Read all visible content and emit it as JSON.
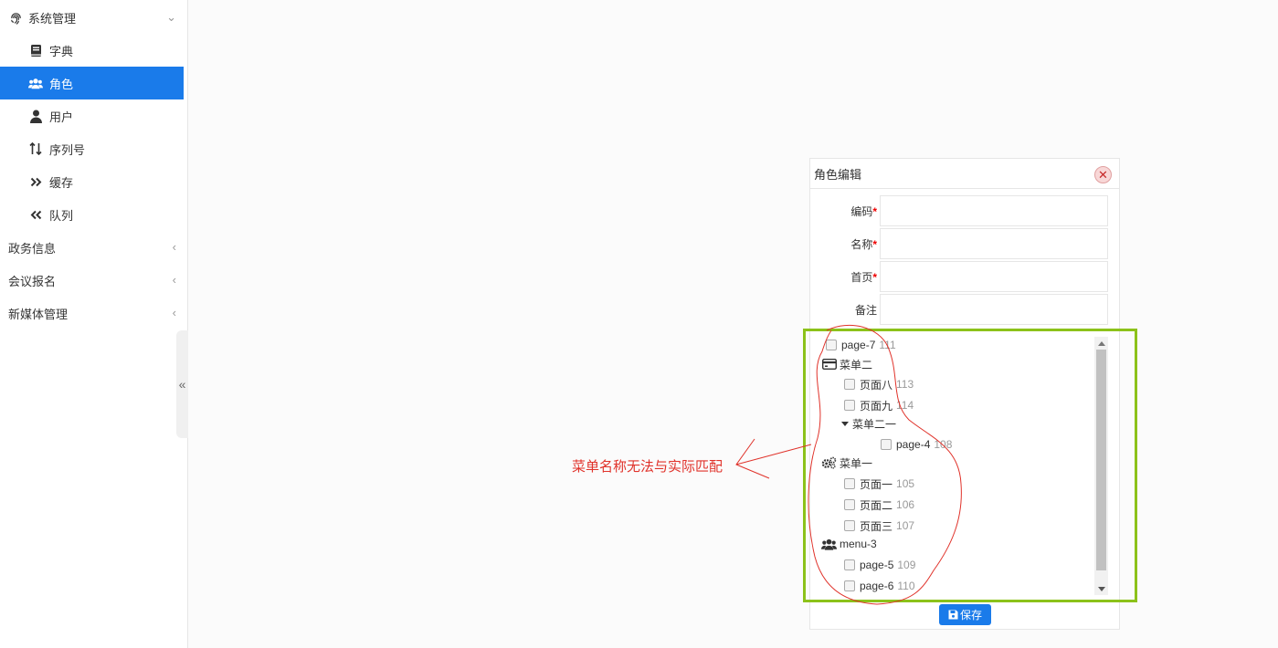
{
  "sidebar": {
    "groups": [
      {
        "label": "系统管理",
        "icon": "fingerprint-icon",
        "expanded": true
      },
      {
        "label": "政务信息",
        "expanded": false
      },
      {
        "label": "会议报名",
        "expanded": false
      },
      {
        "label": "新媒体管理",
        "expanded": false
      }
    ],
    "items": [
      {
        "label": "字典",
        "icon": "book-icon",
        "active": false
      },
      {
        "label": "角色",
        "icon": "users-icon",
        "active": true
      },
      {
        "label": "用户",
        "icon": "user-icon",
        "active": false
      },
      {
        "label": "序列号",
        "icon": "sort-icon",
        "active": false
      },
      {
        "label": "缓存",
        "icon": "double-right-icon",
        "active": false
      },
      {
        "label": "队列",
        "icon": "double-left-icon",
        "active": false
      }
    ],
    "collapse_glyph": "«"
  },
  "dialog": {
    "title": "角色编辑",
    "close_glyph": "✕",
    "fields": [
      {
        "label": "编码",
        "required": true,
        "value": ""
      },
      {
        "label": "名称",
        "required": true,
        "value": ""
      },
      {
        "label": "首页",
        "required": true,
        "value": ""
      },
      {
        "label": "备注",
        "required": false,
        "value": ""
      }
    ],
    "required_mark": "*",
    "tree": [
      {
        "type": "leaf",
        "label": "page-7",
        "id": "111"
      },
      {
        "type": "menu",
        "label": "菜单二",
        "icon": "card-icon"
      },
      {
        "type": "leaf",
        "label": "页面八",
        "id": "113"
      },
      {
        "type": "leaf",
        "label": "页面九",
        "id": "114"
      },
      {
        "type": "submenu",
        "label": "菜单二一"
      },
      {
        "type": "leaf",
        "label": "page-4",
        "id": "108"
      },
      {
        "type": "menu",
        "label": "菜单一",
        "icon": "gears-icon"
      },
      {
        "type": "leaf",
        "label": "页面一",
        "id": "105"
      },
      {
        "type": "leaf",
        "label": "页面二",
        "id": "106"
      },
      {
        "type": "leaf",
        "label": "页面三",
        "id": "107"
      },
      {
        "type": "menu",
        "label": "menu-3",
        "icon": "users-icon"
      },
      {
        "type": "leaf",
        "label": "page-5",
        "id": "109"
      },
      {
        "type": "leaf",
        "label": "page-6",
        "id": "110"
      }
    ],
    "save_label": "保存"
  },
  "annotation": {
    "text": "菜单名称无法与实际匹配",
    "color": "#e0322a",
    "box_color": "#8cc21a"
  },
  "colors": {
    "accent": "#1a7bea"
  }
}
